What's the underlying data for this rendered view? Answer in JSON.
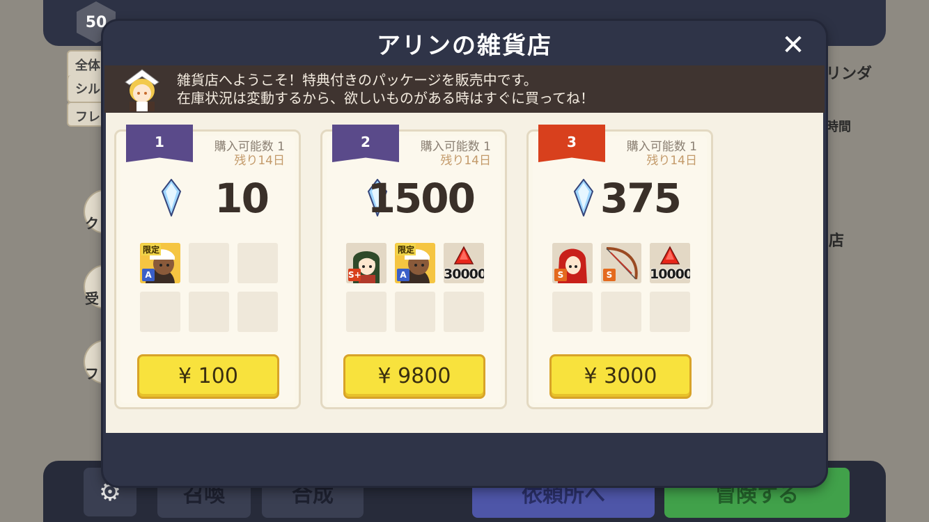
{
  "background": {
    "level": "50",
    "left_tabs": [
      "全体",
      "シル",
      "フレ"
    ],
    "left_circles": [
      "ク",
      "受",
      "フ"
    ],
    "right_labels": [
      "リンダ",
      "時間",
      "店"
    ],
    "bottom_buttons": [
      "召喚",
      "合成",
      "依頼所へ",
      "冒険する"
    ]
  },
  "dialog": {
    "title": "アリンの雑貨店",
    "close_label": "✕",
    "greeting_line1": "雑貨店へようこそ！特典付きのパッケージを販売中です。",
    "greeting_line2": "在庫状況は変動するから、欲しいものがある時はすぐに買ってね！"
  },
  "packages": [
    {
      "number": "1",
      "ribbon_color": "#5a4a8a",
      "limit_text": "購入可能数 1",
      "remaining_text": "残り14日",
      "gems": "10",
      "items": [
        {
          "kind": "character",
          "name": "maid-character",
          "rank": "A",
          "limited_tag": "限定"
        }
      ],
      "price": "¥ 100"
    },
    {
      "number": "2",
      "ribbon_color": "#5a4a8a",
      "limit_text": "購入可能数 1",
      "remaining_text": "残り14日",
      "gems": "1500",
      "items": [
        {
          "kind": "character",
          "name": "green-hair-character",
          "rank": "S+"
        },
        {
          "kind": "character",
          "name": "maid-character",
          "rank": "A",
          "limited_tag": "限定"
        },
        {
          "kind": "material",
          "name": "red-crystal",
          "amount": "30000"
        }
      ],
      "price": "¥ 9800"
    },
    {
      "number": "3",
      "ribbon_color": "#d8401d",
      "limit_text": "購入可能数 1",
      "remaining_text": "残り14日",
      "gems": "375",
      "items": [
        {
          "kind": "character",
          "name": "red-hood-character",
          "rank": "S"
        },
        {
          "kind": "weapon",
          "name": "bow",
          "rank": "S"
        },
        {
          "kind": "material",
          "name": "red-crystal",
          "amount": "10000"
        }
      ],
      "price": "¥ 3000"
    }
  ],
  "colors": {
    "rank_A": "#3a5fc8",
    "rank_S": "#e46a1e",
    "rank_Splus": "#d8401d",
    "buy_button": "#f8e23d"
  }
}
